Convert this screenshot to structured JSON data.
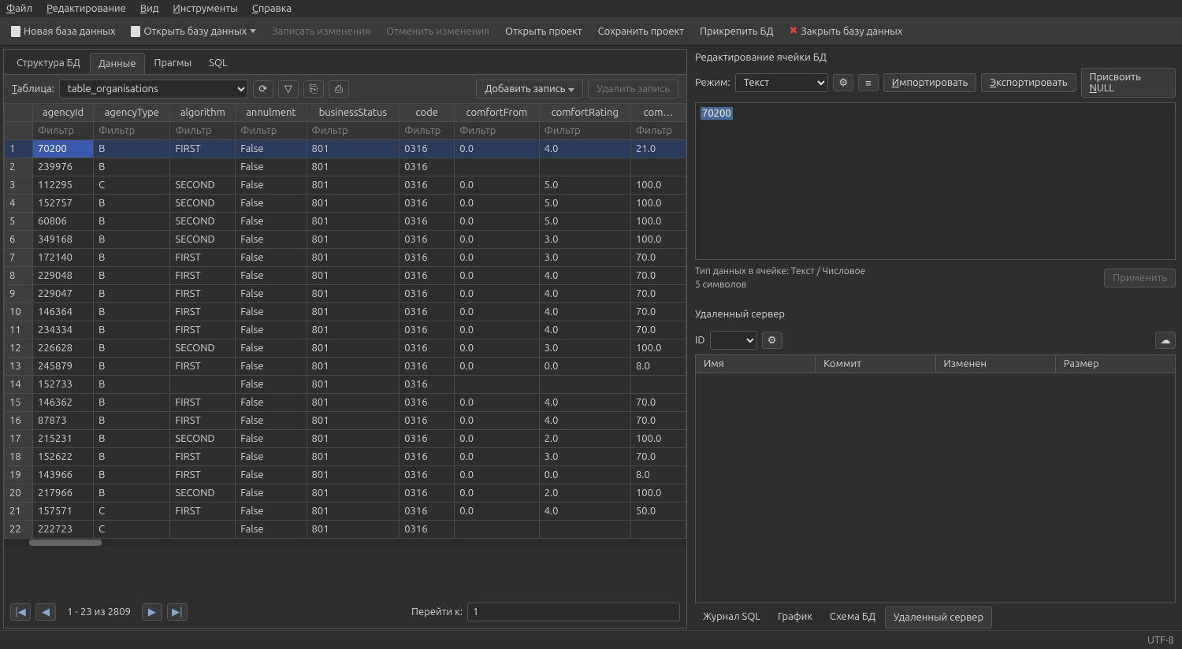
{
  "menu": {
    "file": "Файл",
    "edit": "Редактирование",
    "view": "Вид",
    "tools": "Инструменты",
    "help": "Справка"
  },
  "toolbar": {
    "new_db": "Новая база данных",
    "open_db": "Открыть базу данных",
    "write": "Записать изменения",
    "revert": "Отменить изменения",
    "open_proj": "Открыть проект",
    "save_proj": "Сохранить проект",
    "attach_db": "Прикрепить БД",
    "close_db": "Закрыть базу данных"
  },
  "viewtabs": {
    "structure": "Структура БД",
    "data": "Данные",
    "pragmas": "Прагмы",
    "sql": "SQL"
  },
  "tablebar": {
    "label": "Таблица:",
    "selected": "table_organisations",
    "add": "Добавить запись",
    "del": "Удалить запись"
  },
  "grid": {
    "columns": [
      "agencyId",
      "agencyType",
      "algorithm",
      "annulment",
      "businessStatus",
      "code",
      "comfortFrom",
      "comfortRating",
      "com…"
    ],
    "filter": "Фильтр",
    "rows": [
      {
        "n": "1",
        "c": [
          "70200",
          "B",
          "FIRST",
          "False",
          "801",
          "0316",
          "0.0",
          "4.0",
          "21.0"
        ]
      },
      {
        "n": "2",
        "c": [
          "239976",
          "B",
          "",
          "False",
          "801",
          "0316",
          "",
          "",
          ""
        ]
      },
      {
        "n": "3",
        "c": [
          "112295",
          "C",
          "SECOND",
          "False",
          "801",
          "0316",
          "0.0",
          "5.0",
          "100.0"
        ]
      },
      {
        "n": "4",
        "c": [
          "152757",
          "B",
          "SECOND",
          "False",
          "801",
          "0316",
          "0.0",
          "5.0",
          "100.0"
        ]
      },
      {
        "n": "5",
        "c": [
          "60806",
          "B",
          "SECOND",
          "False",
          "801",
          "0316",
          "0.0",
          "5.0",
          "100.0"
        ]
      },
      {
        "n": "6",
        "c": [
          "349168",
          "B",
          "SECOND",
          "False",
          "801",
          "0316",
          "0.0",
          "3.0",
          "100.0"
        ]
      },
      {
        "n": "7",
        "c": [
          "172140",
          "B",
          "FIRST",
          "False",
          "801",
          "0316",
          "0.0",
          "3.0",
          "70.0"
        ]
      },
      {
        "n": "8",
        "c": [
          "229048",
          "B",
          "FIRST",
          "False",
          "801",
          "0316",
          "0.0",
          "4.0",
          "70.0"
        ]
      },
      {
        "n": "9",
        "c": [
          "229047",
          "B",
          "FIRST",
          "False",
          "801",
          "0316",
          "0.0",
          "4.0",
          "70.0"
        ]
      },
      {
        "n": "10",
        "c": [
          "146364",
          "B",
          "FIRST",
          "False",
          "801",
          "0316",
          "0.0",
          "4.0",
          "70.0"
        ]
      },
      {
        "n": "11",
        "c": [
          "234334",
          "B",
          "FIRST",
          "False",
          "801",
          "0316",
          "0.0",
          "4.0",
          "70.0"
        ]
      },
      {
        "n": "12",
        "c": [
          "226628",
          "B",
          "SECOND",
          "False",
          "801",
          "0316",
          "0.0",
          "3.0",
          "100.0"
        ]
      },
      {
        "n": "13",
        "c": [
          "245879",
          "B",
          "FIRST",
          "False",
          "801",
          "0316",
          "0.0",
          "0.0",
          "8.0"
        ]
      },
      {
        "n": "14",
        "c": [
          "152733",
          "B",
          "",
          "False",
          "801",
          "0316",
          "",
          "",
          ""
        ]
      },
      {
        "n": "15",
        "c": [
          "146362",
          "B",
          "FIRST",
          "False",
          "801",
          "0316",
          "0.0",
          "4.0",
          "70.0"
        ]
      },
      {
        "n": "16",
        "c": [
          "87873",
          "B",
          "FIRST",
          "False",
          "801",
          "0316",
          "0.0",
          "4.0",
          "70.0"
        ]
      },
      {
        "n": "17",
        "c": [
          "215231",
          "B",
          "SECOND",
          "False",
          "801",
          "0316",
          "0.0",
          "2.0",
          "100.0"
        ]
      },
      {
        "n": "18",
        "c": [
          "152622",
          "B",
          "FIRST",
          "False",
          "801",
          "0316",
          "0.0",
          "3.0",
          "70.0"
        ]
      },
      {
        "n": "19",
        "c": [
          "143966",
          "B",
          "FIRST",
          "False",
          "801",
          "0316",
          "0.0",
          "0.0",
          "8.0"
        ]
      },
      {
        "n": "20",
        "c": [
          "217966",
          "B",
          "SECOND",
          "False",
          "801",
          "0316",
          "0.0",
          "2.0",
          "100.0"
        ]
      },
      {
        "n": "21",
        "c": [
          "157571",
          "C",
          "FIRST",
          "False",
          "801",
          "0316",
          "0.0",
          "4.0",
          "50.0"
        ]
      },
      {
        "n": "22",
        "c": [
          "222723",
          "C",
          "",
          "False",
          "801",
          "0316",
          "",
          "",
          ""
        ]
      }
    ]
  },
  "pager": {
    "status": "1 - 23 из 2809",
    "goto": "Перейти к:",
    "value": "1"
  },
  "editor": {
    "title": "Редактирование ячейки БД",
    "mode_label": "Режим:",
    "mode": "Текст",
    "import": "Импортировать",
    "export": "Экспортировать",
    "setnull": "Присвоить NULL",
    "value": "70200",
    "datatype": "Тип данных в ячейке: Текст / Числовое",
    "len": "5 символов",
    "apply": "Применить"
  },
  "remote": {
    "title": "Удаленный сервер",
    "id": "ID",
    "cols": {
      "name": "Имя",
      "commit": "Коммит",
      "modified": "Изменен",
      "size": "Размер"
    }
  },
  "bottom_tabs": {
    "sql": "Журнал SQL",
    "graph": "График",
    "schema": "Схема БД",
    "remote": "Удаленный сервер"
  },
  "status": {
    "encoding": "UTF-8"
  }
}
